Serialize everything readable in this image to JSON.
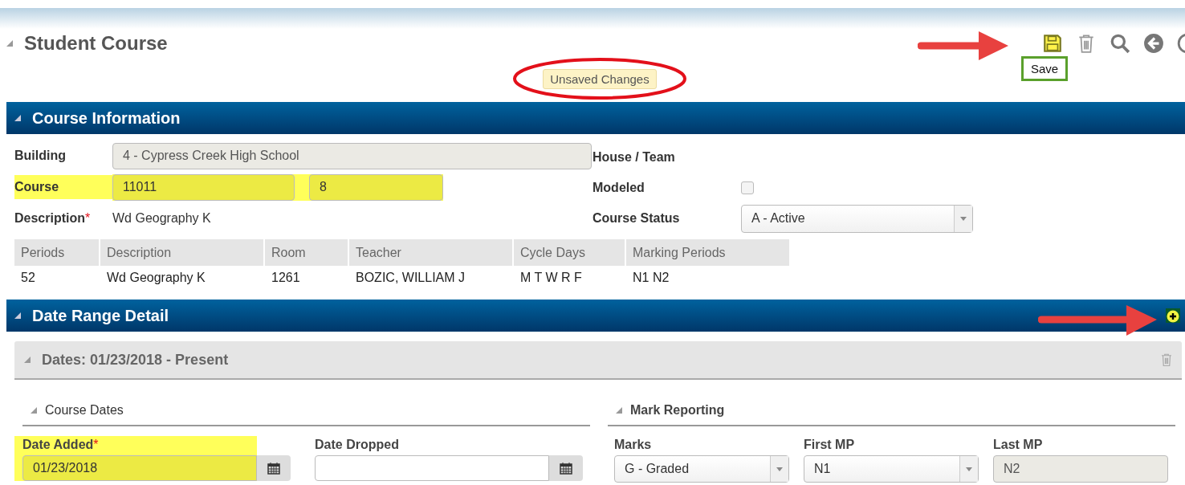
{
  "page": {
    "title": "Student Course",
    "status_badge": {
      "text": "Unsaved Changes",
      "circled": true
    },
    "tooltip": "Save"
  },
  "toolbar": [
    {
      "kind": "save",
      "highlighted": true
    },
    {
      "kind": "delete",
      "highlighted": false
    },
    {
      "kind": "search",
      "highlighted": false
    },
    {
      "kind": "back",
      "highlighted": false
    },
    {
      "kind": "history",
      "highlighted": false
    }
  ],
  "course_information": {
    "title": "Course Information",
    "left_fields": [
      {
        "label": "Building",
        "kind": "readonly",
        "values": [
          "4 - Cypress Creek High School"
        ],
        "highlighted": false
      },
      {
        "label": "Course",
        "kind": "pair",
        "values": [
          "11011",
          "8"
        ],
        "highlighted": true
      },
      {
        "label": "Description",
        "kind": "text",
        "values": [
          "Wd Geography K"
        ],
        "highlighted": false,
        "required_mark": "*"
      }
    ],
    "right_fields": [
      {
        "label": "House / Team",
        "kind": "empty"
      },
      {
        "label": "Modeled",
        "kind": "checkbox",
        "checked": false
      },
      {
        "label": "Course Status",
        "kind": "select",
        "value": "A - Active"
      }
    ],
    "table": {
      "columns": [
        "Periods",
        "Description",
        "Room",
        "Teacher",
        "Cycle Days",
        "Marking Periods"
      ],
      "rows": [
        [
          "52",
          "Wd Geography K",
          "1261",
          "BOZIC, WILLIAM J",
          "M T W R F",
          "N1 N2"
        ]
      ]
    }
  },
  "date_range_detail": {
    "title": "Date Range Detail",
    "add_highlighted": true,
    "panel_title": "Dates: 01/23/2018 - Present",
    "course_dates": {
      "title": "Course Dates",
      "fields": [
        {
          "label": "Date Added",
          "required_mark": "*",
          "value": "01/23/2018",
          "highlighted": true
        },
        {
          "label": "Date Dropped",
          "highlighted": false
        }
      ]
    },
    "mark_reporting": {
      "title": "Mark Reporting",
      "fields": [
        {
          "label": "Marks",
          "kind": "select",
          "value": "G - Graded"
        },
        {
          "label": "First MP",
          "kind": "select",
          "value": "N1"
        },
        {
          "label": "Last MP",
          "kind": "readonly",
          "value": "N2"
        }
      ]
    }
  }
}
